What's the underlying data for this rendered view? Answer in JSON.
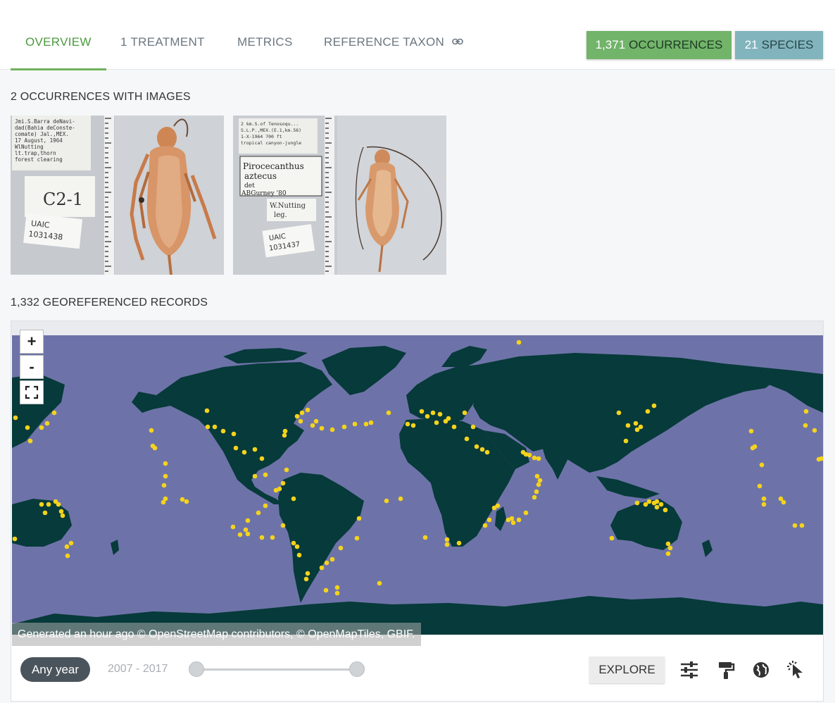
{
  "tabs": [
    {
      "label": "OVERVIEW",
      "active": true
    },
    {
      "label": "1 TREATMENT",
      "active": false
    },
    {
      "label": "METRICS",
      "active": false
    },
    {
      "label": "REFERENCE TAXON",
      "active": false,
      "icon": "link-icon"
    }
  ],
  "badges": {
    "occurrences": {
      "count": "1,371",
      "label": "OCCURRENCES",
      "color": "#71b46a"
    },
    "species": {
      "count": "21",
      "label": "SPECIES",
      "color": "#82b4bd"
    }
  },
  "images_section": {
    "heading": "2 OCCURRENCES WITH IMAGES",
    "images": [
      {
        "label_lines": [
          "Jmi.S.Barra deNavi-",
          "dad(Bahia deConste-",
          "comate) Jal.,MEX.",
          "17 August, 1964",
          "WlNutting",
          "lt.trap,thorn",
          "forest clearing"
        ],
        "field_code": "C2-1",
        "catalog": [
          "UAIC",
          "1031438"
        ]
      },
      {
        "label_lines": [
          "2 km.S.of Tenosoqu...",
          "S.L.P.,MEX.(E.1,km.56)",
          "1-X-1964   700 ft",
          "tropical canyon-jungle"
        ],
        "det_label": [
          "Pirocecanthus",
          "aztecus",
          "det",
          "ABGurney '80"
        ],
        "collector": [
          "W.Nutting",
          "leg."
        ],
        "catalog": [
          "UAIC",
          "1031437"
        ]
      }
    ]
  },
  "map_section": {
    "heading": "1,332 GEOREFERENCED RECORDS",
    "zoom_in": "+",
    "zoom_out": "-",
    "fullscreen_icon": "fullscreen-icon",
    "attribution": "Generated an hour ago © OpenStreetMap contributors, © OpenMapTiles, GBIF.",
    "ocean_color": "#6d73a8",
    "land_color": "#073a3a",
    "point_color": "#f5d31c"
  },
  "map_controls": {
    "year_chip": "Any year",
    "range_label": "2007 - 2017",
    "explore": "EXPLORE",
    "icons": [
      "sliders-icon",
      "paint-roller-icon",
      "globe-icon",
      "pointer-select-icon"
    ]
  }
}
